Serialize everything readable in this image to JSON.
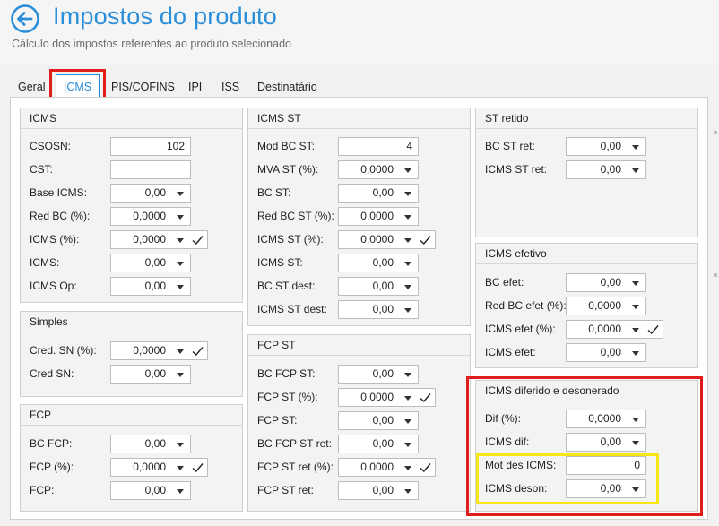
{
  "header": {
    "title": "Impostos do produto",
    "subtitle": "Cálculo dos impostos referentes ao produto selecionado"
  },
  "tabs": [
    {
      "label": "Geral"
    },
    {
      "label": "ICMS"
    },
    {
      "label": "PIS/COFINS"
    },
    {
      "label": "IPI"
    },
    {
      "label": "ISS"
    },
    {
      "label": "Destinatário"
    }
  ],
  "groups": {
    "icms": {
      "title": "ICMS",
      "rows": [
        {
          "label": "CSOSN:",
          "value": "102"
        },
        {
          "label": "CST:",
          "value": ""
        },
        {
          "label": "Base ICMS:",
          "value": "0,00"
        },
        {
          "label": "Red BC (%):",
          "value": "0,0000"
        },
        {
          "label": "ICMS (%):",
          "value": "0,0000"
        },
        {
          "label": "ICMS:",
          "value": "0,00"
        },
        {
          "label": "ICMS Op:",
          "value": "0,00"
        }
      ]
    },
    "simples": {
      "title": "Simples",
      "rows": [
        {
          "label": "Cred. SN (%):",
          "value": "0,0000"
        },
        {
          "label": "Cred SN:",
          "value": "0,00"
        }
      ]
    },
    "fcp": {
      "title": "FCP",
      "rows": [
        {
          "label": "BC FCP:",
          "value": "0,00"
        },
        {
          "label": "FCP (%):",
          "value": "0,0000"
        },
        {
          "label": "FCP:",
          "value": "0,00"
        }
      ]
    },
    "icms_st": {
      "title": "ICMS ST",
      "rows": [
        {
          "label": "Mod BC ST:",
          "value": "4"
        },
        {
          "label": "MVA ST (%):",
          "value": "0,0000"
        },
        {
          "label": "BC ST:",
          "value": "0,00"
        },
        {
          "label": "Red BC ST (%):",
          "value": "0,0000"
        },
        {
          "label": "ICMS ST (%):",
          "value": "0,0000"
        },
        {
          "label": "ICMS ST:",
          "value": "0,00"
        },
        {
          "label": "BC ST dest:",
          "value": "0,00"
        },
        {
          "label": "ICMS ST dest:",
          "value": "0,00"
        }
      ]
    },
    "fcp_st": {
      "title": "FCP ST",
      "rows": [
        {
          "label": "BC FCP ST:",
          "value": "0,00"
        },
        {
          "label": "FCP ST (%):",
          "value": "0,0000"
        },
        {
          "label": "FCP ST:",
          "value": "0,00"
        },
        {
          "label": "BC FCP ST ret:",
          "value": "0,00"
        },
        {
          "label": "FCP ST ret (%):",
          "value": "0,0000"
        },
        {
          "label": "FCP ST ret:",
          "value": "0,00"
        }
      ]
    },
    "st_retido": {
      "title": "ST retido",
      "rows": [
        {
          "label": "BC ST ret:",
          "value": "0,00"
        },
        {
          "label": "ICMS ST ret:",
          "value": "0,00"
        }
      ]
    },
    "icms_efetivo": {
      "title": "ICMS efetivo",
      "rows": [
        {
          "label": "BC efet:",
          "value": "0,00"
        },
        {
          "label": "Red BC efet (%):",
          "value": "0,0000"
        },
        {
          "label": "ICMS efet (%):",
          "value": "0,0000"
        },
        {
          "label": "ICMS efet:",
          "value": "0,00"
        }
      ]
    },
    "icms_diferido": {
      "title": "ICMS diferido e desonerado",
      "rows": [
        {
          "label": "Dif (%):",
          "value": "0,0000"
        },
        {
          "label": "ICMS dif:",
          "value": "0,00"
        },
        {
          "label": "Mot des ICMS:",
          "value": "0"
        },
        {
          "label": "ICMS deson:",
          "value": "0,00"
        }
      ]
    }
  },
  "colors": {
    "accent": "#2a8ed8",
    "highlight_red": "#e21b1b",
    "highlight_yellow": "#f7e615"
  }
}
